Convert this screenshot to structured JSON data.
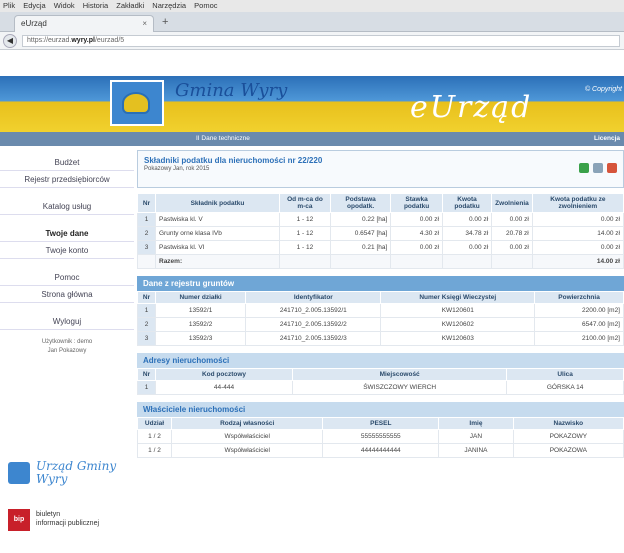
{
  "browser": {
    "menu": [
      "Plik",
      "Edycja",
      "Widok",
      "Historia",
      "Zakładki",
      "Narzędzia",
      "Pomoc"
    ],
    "tab_title": "eUrząd",
    "url_prefix": "https://eurzad.",
    "url_domain": "wyry.pl",
    "url_path": "/eurzad/5"
  },
  "header": {
    "gmina_title": "Gmina Wyry",
    "brand": "eUrząd",
    "copyright": "© Copyright",
    "crumbs": "II Dane techniczne",
    "license": "Licencja"
  },
  "sidebar": {
    "items": [
      "Budżet",
      "Rejestr przedsiębiorców",
      "Katalog usług",
      "Twoje dane",
      "Twoje konto",
      "Pomoc",
      "Strona główna",
      "Wyloguj"
    ],
    "user_line1": "Użytkownik : demo",
    "user_line2": "Jan Pokazowy",
    "urzad_logo": "Urząd Gminy Wyry",
    "bip_badge": "bip",
    "bip_line1": "biuletyn",
    "bip_line2": "informacji publicznej"
  },
  "tax": {
    "title": "Składniki podatku dla nieruchomości nr 22/220",
    "subtitle": "Pokazowy Jan, rok 2015",
    "headers": [
      "Nr",
      "Składnik podatku",
      "Od m-ca do m-ca",
      "Podstawa opodatk.",
      "Stawka podatku",
      "Kwota podatku",
      "Zwolnienia",
      "Kwota podatku ze zwolnieniem"
    ],
    "rows": [
      [
        "1",
        "Pastwiska kl. V",
        "1 - 12",
        "0.22 [ha]",
        "0.00 zł",
        "0.00 zł",
        "0.00 zł",
        "0.00 zł"
      ],
      [
        "2",
        "Grunty orne klasa IVb",
        "1 - 12",
        "0.6547 [ha]",
        "4.30 zł",
        "34.78 zł",
        "20.78 zł",
        "14.00 zł"
      ],
      [
        "3",
        "Pastwiska kl. VI",
        "1 - 12",
        "0.21 [ha]",
        "0.00 zł",
        "0.00 zł",
        "0.00 zł",
        "0.00 zł"
      ]
    ],
    "sum_label": "Razem:",
    "sum_value": "14.00 zł"
  },
  "registry": {
    "title": "Dane z rejestru gruntów",
    "headers": [
      "Nr",
      "Numer działki",
      "Identyfikator",
      "Numer Księgi Wieczystej",
      "Powierzchnia"
    ],
    "rows": [
      [
        "1",
        "13592/1",
        "241710_2.005.13592/1",
        "KW120601",
        "2200.00 [m2]"
      ],
      [
        "2",
        "13592/2",
        "241710_2.005.13592/2",
        "KW120602",
        "6547.00 [m2]"
      ],
      [
        "3",
        "13592/3",
        "241710_2.005.13592/3",
        "KW120603",
        "2100.00 [m2]"
      ]
    ]
  },
  "address": {
    "title": "Adresy nieruchomości",
    "headers": [
      "Nr",
      "Kod pocztowy",
      "Miejscowość",
      "Ulica"
    ],
    "rows": [
      [
        "1",
        "44-444",
        "ŚWISZCZOWY WIERCH",
        "GÓRSKA 14"
      ]
    ]
  },
  "owners": {
    "title": "Właściciele nieruchomości",
    "headers": [
      "Udział",
      "Rodzaj własności",
      "PESEL",
      "Imię",
      "Nazwisko"
    ],
    "rows": [
      [
        "1 / 2",
        "Współwłaściciel",
        "55555555555",
        "JAN",
        "POKAZOWY"
      ],
      [
        "1 / 2",
        "Współwłaściciel",
        "44444444444",
        "JANINA",
        "POKAZOWA"
      ]
    ]
  }
}
